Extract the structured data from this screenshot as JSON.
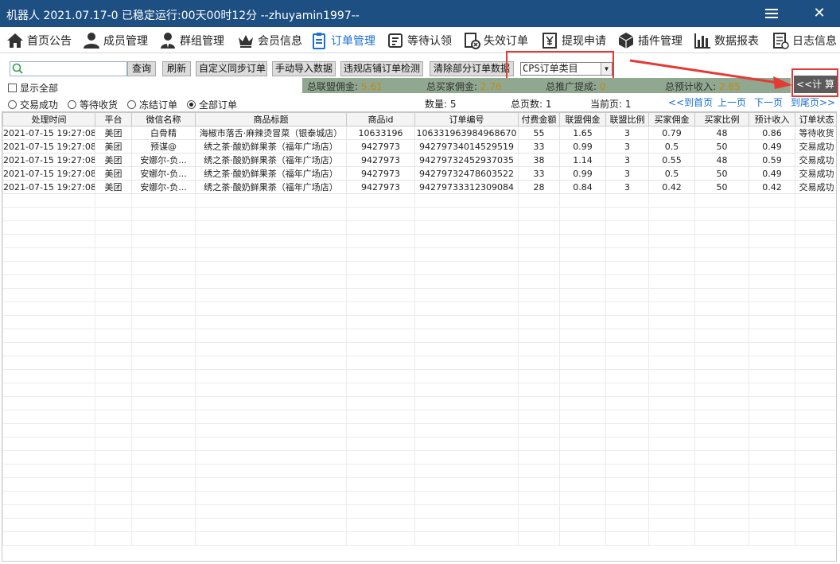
{
  "window": {
    "title": "机器人  2021.07.17-0 已稳定运行:00天00时12分   --zhuyamin1997--",
    "menu_icon": "hamburger-icon",
    "close_label": "✕"
  },
  "nav": [
    {
      "label": "首页公告",
      "icon": "home-icon"
    },
    {
      "label": "成员管理",
      "icon": "user-icon"
    },
    {
      "label": "群组管理",
      "icon": "group-icon"
    },
    {
      "label": "会员信息",
      "icon": "crown-icon"
    },
    {
      "label": "订单管理",
      "icon": "clipboard-icon",
      "active": true
    },
    {
      "label": "等待认领",
      "icon": "wait-icon"
    },
    {
      "label": "失效订单",
      "icon": "invalid-icon"
    },
    {
      "label": "提现申请",
      "icon": "yuan-icon"
    },
    {
      "label": "插件管理",
      "icon": "cube-icon"
    },
    {
      "label": "数据报表",
      "icon": "bar-chart-icon"
    },
    {
      "label": "日志信息",
      "icon": "log-icon"
    }
  ],
  "toolbar": {
    "search_value": "",
    "buttons": [
      "查询",
      "刷新",
      "自定义同步订单",
      "手动导入数据",
      "违规店铺订单检测",
      "清除部分订单数据"
    ],
    "select_value": "CPS订单类目",
    "show_all": "显示全部",
    "calc_label": "<<计 算"
  },
  "summary": {
    "alliance_label": "总联盟佣金:",
    "alliance_value": "5.61",
    "buyer_label": "总买家佣金:",
    "buyer_value": "2.76",
    "promo_label": "总推广提成:",
    "promo_value": "0",
    "income_label": "总预计收入:",
    "income_value": "2.85"
  },
  "filters": [
    {
      "label": "交易成功",
      "checked": false
    },
    {
      "label": "等待收货",
      "checked": false
    },
    {
      "label": "冻结订单",
      "checked": false
    },
    {
      "label": "全部订单",
      "checked": true
    }
  ],
  "info": {
    "count": "数量: 5",
    "total_pages": "总页数: 1",
    "current_page": "当前页: 1"
  },
  "pager": [
    "<<到首页",
    "上一页",
    "下一页",
    "到尾页>>"
  ],
  "table": {
    "headers": [
      "处理时间",
      "平台",
      "微信名称",
      "商品标题",
      "商品id",
      "订单编号",
      "付费金额",
      "联盟佣金",
      "联盟比例",
      "买家佣金",
      "买家比例",
      "预计收入",
      "订单状态"
    ],
    "rows": [
      [
        "2021-07-15 19:27:08",
        "美团",
        "白骨精",
        "海椒市落舌·麻辣烫冒菜（银泰城店）",
        "10633196",
        "106331963984968670",
        "55",
        "1.65",
        "3",
        "0.79",
        "48",
        "0.86",
        "等待收货"
      ],
      [
        "2021-07-15 19:27:08",
        "美团",
        "预谋@",
        "绣之茶·酸奶鲜果茶（福年广场店）",
        "9427973",
        "94279734014529519",
        "33",
        "0.99",
        "3",
        "0.5",
        "50",
        "0.49",
        "交易成功"
      ],
      [
        "2021-07-15 19:27:08",
        "美团",
        "安娜尔-负...",
        "绣之茶·酸奶鲜果茶（福年广场店）",
        "9427973",
        "94279732452937035",
        "38",
        "1.14",
        "3",
        "0.55",
        "48",
        "0.59",
        "交易成功"
      ],
      [
        "2021-07-15 19:27:08",
        "美团",
        "安娜尔-负...",
        "绣之茶·酸奶鲜果茶（福年广场店）",
        "9427973",
        "94279732478603522",
        "33",
        "0.99",
        "3",
        "0.5",
        "50",
        "0.49",
        "交易成功"
      ],
      [
        "2021-07-15 19:27:08",
        "美团",
        "安娜尔-负...",
        "绣之茶·酸奶鲜果茶（福年广场店）",
        "9427973",
        "94279733312309084",
        "28",
        "0.84",
        "3",
        "0.42",
        "50",
        "0.42",
        "交易成功"
      ]
    ]
  },
  "colors": {
    "titlebar": "#1e4f82",
    "accent": "#1a6fd3",
    "summary_bar": "#8fa88f",
    "summary_value": "#c48a1a",
    "annotation_red": "#e53935"
  }
}
